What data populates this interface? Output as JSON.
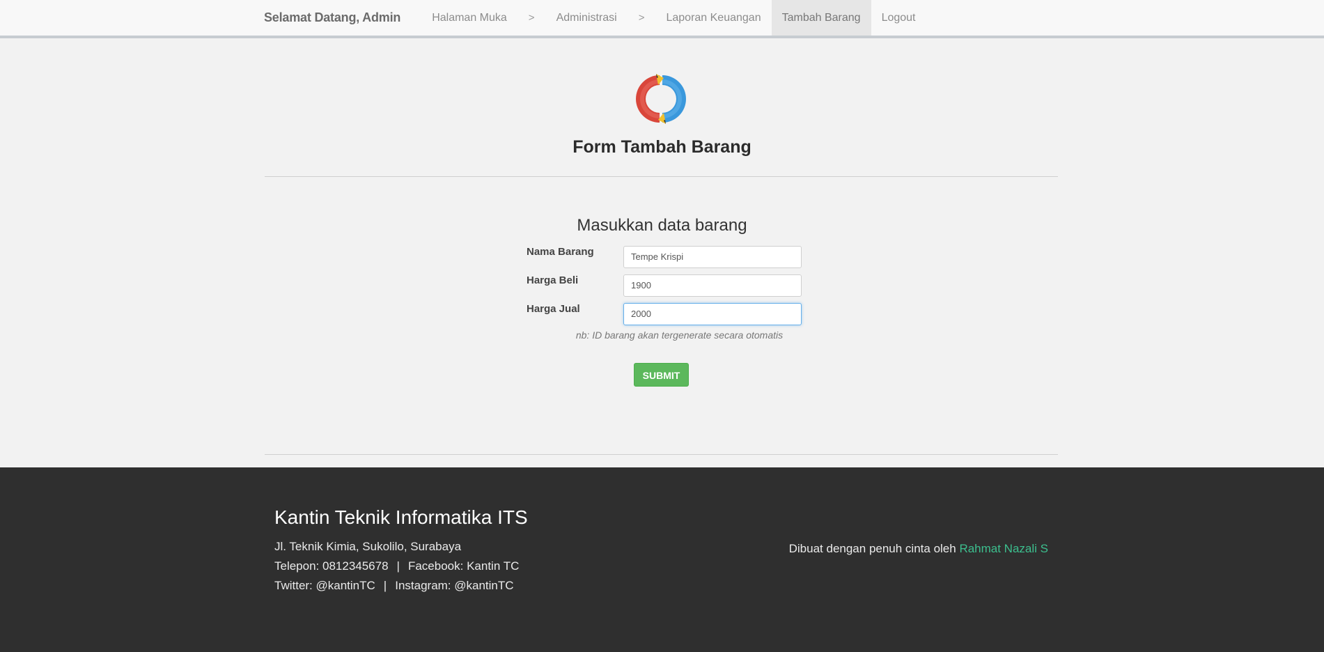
{
  "navbar": {
    "brand": "Selamat Datang, Admin",
    "items": [
      {
        "label": "Halaman Muka"
      },
      {
        "label": "Administrasi"
      },
      {
        "label": "Laporan Keuangan"
      },
      {
        "label": "Tambah Barang"
      },
      {
        "label": "Logout"
      }
    ],
    "separator": ">"
  },
  "header": {
    "logo_icon": "refresh-cycle-logo-icon",
    "title": "Form Tambah Barang"
  },
  "form": {
    "subtitle": "Masukkan data barang",
    "fields": [
      {
        "label": "Nama Barang",
        "value": "Tempe Krispi"
      },
      {
        "label": "Harga Beli",
        "value": "1900"
      },
      {
        "label": "Harga Jual",
        "value": "2000"
      }
    ],
    "note": "nb: ID barang akan tergenerate secara otomatis",
    "submit_label": "SUBMIT"
  },
  "footer": {
    "title": "Kantin Teknik Informatika ITS",
    "address": "Jl. Teknik Kimia, Sukolilo, Surabaya",
    "phone": "Telepon: 0812345678",
    "facebook": "Facebook: Kantin TC",
    "twitter": "Twitter: @kantinTC",
    "instagram": "Instagram: @kantinTC",
    "divider": "|",
    "credit_text": "Dibuat dengan penuh cinta oleh ",
    "credit_name": "Rahmat Nazali S"
  },
  "colors": {
    "submit": "#5cb85c",
    "footer_bg": "#2f2f2f",
    "credit_link": "#3cbf8e",
    "input_focus": "#66afe9"
  }
}
